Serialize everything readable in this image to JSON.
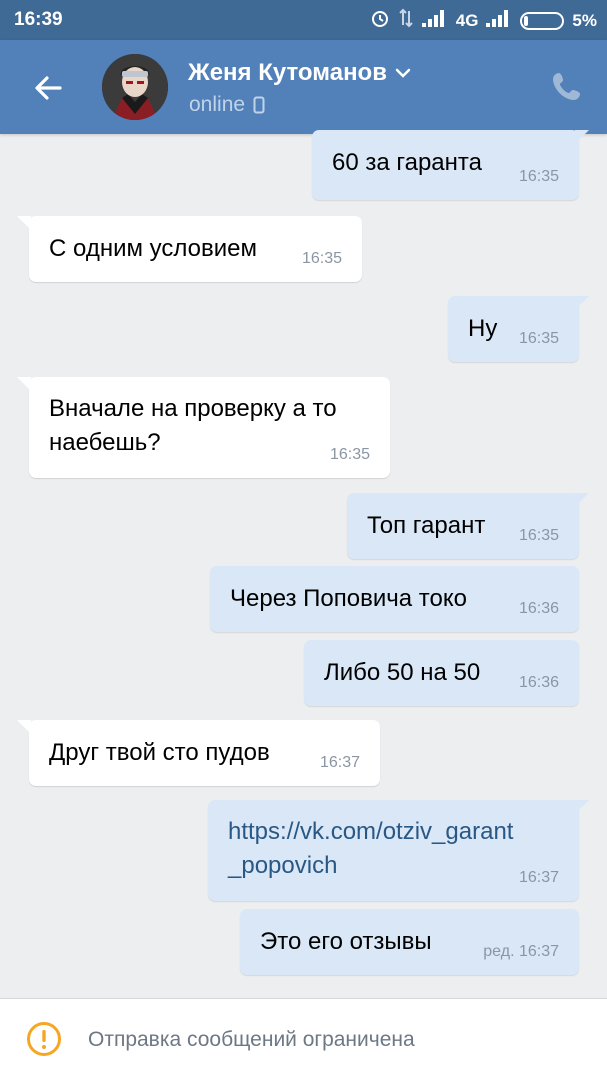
{
  "status_bar": {
    "time": "16:39",
    "network": "4G",
    "battery": "5%"
  },
  "header": {
    "name": "Женя Кутоманов",
    "status": "online"
  },
  "messages": [
    {
      "text": "60 за гаранта",
      "time": "16:35",
      "direction": "out"
    },
    {
      "text": "С одним условием",
      "time": "16:35",
      "direction": "in"
    },
    {
      "text": "Ну",
      "time": "16:35",
      "direction": "out"
    },
    {
      "text_line1": "Вначале на проверку а то",
      "text_line2": "наебешь?",
      "time": "16:35",
      "direction": "in"
    },
    {
      "text": "Топ гарант",
      "time": "16:35",
      "direction": "out"
    },
    {
      "text": "Через Поповича токо",
      "time": "16:36",
      "direction": "out"
    },
    {
      "text": "Либо 50 на 50",
      "time": "16:36",
      "direction": "out"
    },
    {
      "text": "Друг твой сто пудов",
      "time": "16:37",
      "direction": "in"
    },
    {
      "text_line1": "https://vk.com/otziv_garant",
      "text_line2": "_popovich",
      "time": "16:37",
      "direction": "out"
    },
    {
      "text": "Это его отзывы",
      "time": "ред. 16:37",
      "direction": "out"
    }
  ],
  "footer": {
    "text": "Отправка сообщений ограничена"
  },
  "colors": {
    "header": "#5181b8",
    "status_bar": "#3f6a96",
    "incoming": "#ffffff",
    "outgoing": "#d9e7f7",
    "background": "#edeef0",
    "warning": "#f5a623"
  }
}
